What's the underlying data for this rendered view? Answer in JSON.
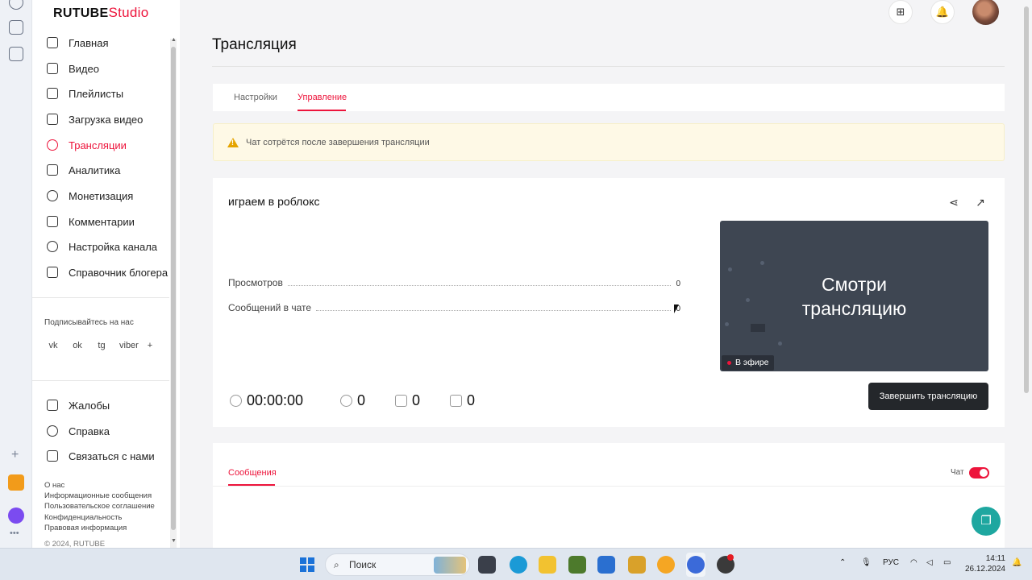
{
  "app": {
    "logo_main": "RUTUBE",
    "logo_sub": "Studio"
  },
  "sidebar": {
    "items": [
      {
        "label": "Главная",
        "icon": "home-icon"
      },
      {
        "label": "Видео",
        "icon": "video-icon"
      },
      {
        "label": "Плейлисты",
        "icon": "playlist-icon"
      },
      {
        "label": "Загрузка видео",
        "icon": "upload-icon"
      },
      {
        "label": "Трансляции",
        "icon": "broadcast-icon",
        "active": true
      },
      {
        "label": "Аналитика",
        "icon": "analytics-icon"
      },
      {
        "label": "Монетизация",
        "icon": "ruble-icon"
      },
      {
        "label": "Комментарии",
        "icon": "comment-icon"
      },
      {
        "label": "Настройка канала",
        "icon": "gear-icon"
      },
      {
        "label": "Справочник блогера",
        "icon": "handbook-icon"
      }
    ],
    "subscribe_label": "Подписывайтесь на нас",
    "social": [
      "vk",
      "ok",
      "tg",
      "viber",
      "+"
    ],
    "secondary": [
      {
        "label": "Жалобы",
        "icon": "flag-icon"
      },
      {
        "label": "Справка",
        "icon": "help-icon"
      },
      {
        "label": "Связаться с нами",
        "icon": "mail-icon"
      }
    ],
    "footer_links": [
      "О нас",
      "Информационные сообщения",
      "Пользовательское соглашение",
      "Конфиденциальность",
      "Правовая информация",
      "© 2024, RUTUBE"
    ]
  },
  "page": {
    "title": "Трансляция",
    "tabs": [
      "Настройки",
      "Управление"
    ],
    "warning": "Чат сотрётся после завершения трансляции"
  },
  "stream": {
    "title": "играем в роблокс",
    "stats": [
      {
        "label": "Просмотров",
        "value": "0"
      },
      {
        "label": "Сообщений в чате",
        "value": "0"
      }
    ],
    "preview_text_1": "Смотри",
    "preview_text_2": "трансляцию",
    "live_badge": "В эфире",
    "timer": "00:00:00",
    "viewers": "0",
    "likes": "0",
    "dislikes": "0",
    "end_button": "Завершить трансляцию"
  },
  "messages": {
    "tab": "Сообщения",
    "chat_label": "Чат",
    "chat_enabled": true
  },
  "taskbar": {
    "search_placeholder": "Поиск",
    "lang": "РУС",
    "time": "14:11",
    "date": "26.12.2024"
  },
  "colors": {
    "accent": "#ed143b",
    "end_button": "#24272b",
    "support": "#1ea7a0",
    "warning_bg": "#fef9e6"
  }
}
